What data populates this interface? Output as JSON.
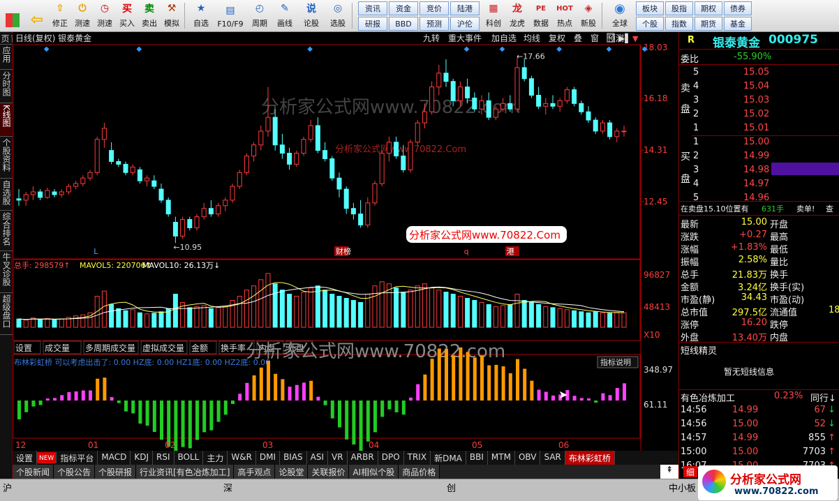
{
  "toolbar": {
    "nav": [
      {
        "label": "",
        "icon": "back-arrow-icon"
      },
      {
        "label": "修正",
        "icon": "up-arrow-icon"
      },
      {
        "label": "测速",
        "icon": "power-icon"
      },
      {
        "label": "测速",
        "icon": "clock-icon"
      },
      {
        "label": "买入",
        "icon": "buy-icon",
        "glyph": "买"
      },
      {
        "label": "卖出",
        "icon": "sell-icon",
        "glyph": "卖"
      },
      {
        "label": "模拟",
        "icon": "hammer-icon"
      }
    ],
    "mid": [
      {
        "label": "自选"
      },
      {
        "label": "F10/F9"
      },
      {
        "label": "周期"
      },
      {
        "label": "画线"
      },
      {
        "label": "论股"
      },
      {
        "label": "选股"
      }
    ],
    "grid1": [
      "资讯",
      "资金",
      "竞价",
      "陆港",
      "研报",
      "BBD",
      "预测",
      "沪伦"
    ],
    "apps": [
      {
        "label": "科创"
      },
      {
        "label": "龙虎"
      },
      {
        "label": "数据",
        "glyph": "PE"
      },
      {
        "label": "热点",
        "glyph": "HOT"
      },
      {
        "label": "新股"
      }
    ],
    "global": "全球",
    "grid2": [
      "板块",
      "股指",
      "期权",
      "债券",
      "个股",
      "指数",
      "期货",
      "基金"
    ]
  },
  "leftnav": [
    "首页",
    "应用",
    "分时图",
    "K线图",
    "个股资料",
    "自选股",
    "综合排名",
    "牛叉诊股",
    "超级盘口"
  ],
  "chart": {
    "header": "日线(复权)  银泰黄金",
    "buttons": [
      "九转",
      "重大事件",
      "加自选",
      "均线",
      "复权",
      "叠",
      "窗",
      "预测"
    ],
    "price_ticks": [
      "18.03",
      "16.18",
      "14.31",
      "12.45"
    ],
    "annot_high": "17.66",
    "annot_low": "10.95",
    "markers": [
      {
        "t": "L",
        "c": "#4af"
      },
      {
        "t": "财榜",
        "c": "#fff",
        "bg": "#a00"
      },
      {
        "t": "q",
        "c": "#f44"
      },
      {
        "t": "港",
        "c": "#fff",
        "bg": "#a00"
      }
    ],
    "watermark1": "分析家公式网www.70822.com",
    "watermark2": "分析家公式网www.70822.Com",
    "watermark3": "分析家公式网www.70822.Com",
    "watermark4": "分析家公式网www.70822.com",
    "vol_header": {
      "total": "总手: 298579↑",
      "ma5": "MAVOL5: 220706↑",
      "ma10": "MAVOL10: 26.13万↓"
    },
    "vol_ticks": [
      "96827",
      "48413",
      "X10"
    ],
    "vol_tabs": [
      "设置",
      "成交量",
      "多周期成交量",
      "虚拟成交量",
      "金额",
      "换手率",
      "内盘",
      "外盘"
    ],
    "ind_header": "布林彩虹桥  可以考虑出击了: 0.00  HZ底: 0.00  HZ1底: 0.00  HZ2底: 0.00",
    "ind_btn": "指标说明",
    "ind_ticks": [
      "348.97",
      "61.11"
    ],
    "months": [
      "12",
      "01",
      "02",
      "03",
      "04",
      "05",
      "06"
    ]
  },
  "chart_data": [
    {
      "type": "candlestick",
      "title": "银泰黄金 日线(复权)",
      "ylim": [
        10.5,
        18.03
      ],
      "ohlc": [
        [
          12.55,
          12.9,
          12.3,
          12.5
        ],
        [
          12.5,
          12.8,
          12.3,
          12.7
        ],
        [
          12.7,
          13.0,
          12.5,
          12.8
        ],
        [
          12.8,
          12.9,
          12.5,
          12.6
        ],
        [
          12.6,
          12.95,
          12.55,
          12.85
        ],
        [
          12.8,
          12.9,
          12.6,
          12.7
        ],
        [
          12.7,
          12.9,
          12.6,
          12.8
        ],
        [
          12.8,
          13.1,
          12.7,
          13.0
        ],
        [
          13.0,
          13.2,
          12.9,
          13.1
        ],
        [
          13.1,
          13.4,
          13.0,
          13.3
        ],
        [
          13.3,
          13.6,
          13.2,
          13.5
        ],
        [
          13.5,
          14.8,
          13.4,
          14.7
        ],
        [
          14.7,
          15.3,
          14.4,
          15.1
        ],
        [
          14.3,
          14.6,
          13.8,
          13.9
        ],
        [
          13.9,
          14.0,
          13.7,
          13.8
        ],
        [
          13.8,
          13.9,
          13.4,
          13.5
        ],
        [
          13.5,
          13.8,
          13.4,
          13.7
        ],
        [
          13.6,
          13.7,
          13.1,
          13.2
        ],
        [
          13.2,
          13.4,
          13.0,
          13.3
        ],
        [
          13.2,
          13.4,
          12.9,
          13.0
        ],
        [
          12.9,
          13.1,
          12.4,
          12.5
        ],
        [
          12.5,
          12.6,
          11.9,
          12.0
        ],
        [
          11.7,
          11.9,
          10.95,
          11.2
        ],
        [
          11.2,
          11.9,
          11.1,
          11.8
        ],
        [
          11.8,
          11.9,
          11.4,
          11.5
        ],
        [
          11.5,
          12.0,
          11.4,
          11.9
        ],
        [
          11.9,
          12.4,
          11.8,
          12.2
        ],
        [
          12.2,
          12.5,
          11.9,
          12.0
        ],
        [
          12.0,
          12.4,
          11.9,
          12.3
        ],
        [
          12.3,
          12.6,
          12.1,
          12.5
        ],
        [
          12.5,
          13.1,
          12.4,
          13.0
        ],
        [
          13.0,
          13.6,
          12.9,
          13.5
        ],
        [
          13.5,
          14.2,
          13.4,
          14.1
        ],
        [
          14.1,
          14.6,
          13.9,
          14.5
        ],
        [
          14.5,
          15.2,
          14.3,
          15.0
        ],
        [
          15.0,
          16.6,
          14.8,
          15.5
        ],
        [
          15.5,
          15.8,
          14.3,
          14.5
        ],
        [
          14.5,
          14.9,
          14.0,
          14.2
        ],
        [
          14.2,
          14.4,
          13.6,
          13.8
        ],
        [
          13.8,
          14.3,
          13.7,
          14.2
        ],
        [
          14.2,
          14.8,
          14.1,
          14.7
        ],
        [
          14.7,
          15.4,
          14.6,
          15.2
        ],
        [
          15.2,
          15.5,
          14.2,
          14.3
        ],
        [
          14.3,
          14.6,
          13.9,
          14.0
        ],
        [
          14.0,
          14.1,
          13.2,
          13.3
        ],
        [
          13.3,
          13.5,
          12.6,
          12.9
        ],
        [
          12.9,
          13.0,
          12.0,
          12.2
        ],
        [
          12.2,
          12.4,
          11.8,
          12.0
        ],
        [
          12.0,
          12.5,
          11.5,
          11.6
        ],
        [
          11.6,
          12.6,
          11.5,
          12.4
        ],
        [
          12.4,
          13.2,
          12.3,
          13.1
        ],
        [
          13.1,
          14.3,
          13.0,
          14.2
        ],
        [
          14.2,
          14.8,
          13.9,
          14.6
        ],
        [
          14.6,
          14.8,
          14.0,
          14.1
        ],
        [
          14.1,
          14.5,
          13.5,
          13.6
        ],
        [
          13.6,
          14.7,
          13.5,
          14.6
        ],
        [
          14.6,
          15.4,
          14.5,
          15.3
        ],
        [
          15.3,
          16.0,
          15.1,
          15.7
        ],
        [
          15.7,
          16.8,
          15.6,
          16.6
        ],
        [
          16.6,
          17.4,
          16.3,
          17.1
        ],
        [
          17.1,
          17.6,
          16.6,
          16.8
        ],
        [
          16.8,
          16.9,
          15.9,
          16.1
        ],
        [
          16.1,
          16.8,
          15.9,
          16.6
        ],
        [
          16.6,
          16.9,
          16.0,
          16.2
        ],
        [
          16.2,
          16.4,
          15.7,
          15.8
        ],
        [
          15.8,
          16.3,
          15.6,
          16.1
        ],
        [
          16.1,
          16.4,
          15.4,
          15.5
        ],
        [
          15.5,
          15.9,
          15.4,
          15.8
        ],
        [
          15.8,
          16.2,
          15.7,
          16.0
        ],
        [
          16.0,
          16.3,
          15.7,
          15.8
        ],
        [
          15.8,
          17.66,
          15.7,
          17.3
        ],
        [
          17.3,
          17.6,
          16.8,
          16.9
        ],
        [
          16.9,
          17.0,
          16.2,
          16.3
        ],
        [
          16.3,
          16.6,
          15.8,
          15.9
        ],
        [
          15.9,
          16.2,
          15.6,
          16.0
        ],
        [
          16.0,
          16.3,
          15.8,
          15.9
        ],
        [
          15.9,
          16.2,
          15.7,
          16.1
        ],
        [
          16.1,
          16.6,
          16.0,
          16.5
        ],
        [
          16.5,
          16.6,
          15.9,
          16.0
        ],
        [
          16.0,
          16.1,
          15.6,
          15.7
        ],
        [
          15.7,
          15.9,
          15.3,
          15.4
        ],
        [
          15.4,
          15.5,
          14.9,
          15.0
        ],
        [
          15.0,
          15.4,
          14.9,
          15.3
        ],
        [
          15.3,
          15.4,
          14.7,
          14.8
        ],
        [
          14.8,
          15.1,
          14.6,
          15.0
        ],
        [
          15.0,
          15.2,
          14.8,
          15.0
        ]
      ]
    },
    {
      "type": "bar",
      "title": "成交量",
      "series": [
        {
          "name": "总手",
          "values": [
            40,
            35,
            45,
            38,
            42,
            36,
            40,
            48,
            55,
            60,
            70,
            150,
            175,
            110,
            90,
            80,
            85,
            70,
            65,
            68,
            75,
            90,
            160,
            120,
            95,
            100,
            105,
            90,
            95,
            100,
            130,
            150,
            180,
            200,
            230,
            260,
            210,
            180,
            160,
            150,
            170,
            190,
            200,
            180,
            160,
            150,
            140,
            130,
            120,
            160,
            200,
            220,
            210,
            190,
            170,
            180,
            200,
            210,
            190,
            180,
            170,
            160,
            150,
            140,
            130,
            120,
            110,
            100,
            105,
            110,
            160,
            130,
            120,
            110,
            100,
            95,
            90,
            85,
            80,
            75,
            70,
            75,
            70,
            68,
            72,
            70
          ]
        },
        {
          "name": "MAVOL5",
          "values": [
            220706
          ]
        },
        {
          "name": "MAVOL10",
          "values": [
            261300
          ]
        }
      ]
    },
    {
      "type": "bar",
      "title": "布林彩虹桥",
      "ylim": [
        -150,
        348.97
      ]
    }
  ],
  "quote": {
    "code": "R",
    "name": "银泰黄金",
    "stock_code": "000975",
    "wb_label": "委比",
    "wb": "-55.90%",
    "sell_label": [
      "卖",
      "盘"
    ],
    "buy_label": [
      "买",
      "盘"
    ],
    "asks": [
      {
        "lv": "5",
        "p": "15.05",
        "v": ""
      },
      {
        "lv": "4",
        "p": "15.04",
        "v": ""
      },
      {
        "lv": "3",
        "p": "15.03",
        "v": ""
      },
      {
        "lv": "2",
        "p": "15.02",
        "v": ""
      },
      {
        "lv": "1",
        "p": "15.01",
        "v": ""
      }
    ],
    "bids": [
      {
        "lv": "1",
        "p": "15.00",
        "v": ""
      },
      {
        "lv": "2",
        "p": "14.99",
        "v": ""
      },
      {
        "lv": "3",
        "p": "14.98",
        "v": ""
      },
      {
        "lv": "4",
        "p": "14.97",
        "v": ""
      },
      {
        "lv": "5",
        "p": "14.96",
        "v": ""
      }
    ],
    "notice": "在卖盘15.10位置有",
    "notice_vol": "631手",
    "notice_tail": "卖单!",
    "notice_btn": "查",
    "stats": [
      [
        "最新",
        "15.00",
        "开盘",
        ""
      ],
      [
        "涨跌",
        "+0.27",
        "最高",
        ""
      ],
      [
        "涨幅",
        "+1.83%",
        "最低",
        ""
      ],
      [
        "振幅",
        "2.58%",
        "量比",
        ""
      ],
      [
        "总手",
        "21.83万",
        "换手",
        ""
      ],
      [
        "金额",
        "3.24亿",
        "换手(实)",
        ""
      ],
      [
        "市盈(静)",
        "34.43",
        "市盈(动)",
        ""
      ],
      [
        "总市值",
        "297.5亿",
        "流通值",
        "18"
      ],
      [
        "涨停",
        "16.20",
        "跌停",
        ""
      ],
      [
        "外盘",
        "13.40万",
        "内盘",
        ""
      ]
    ],
    "short_title": "短线精灵",
    "short_empty": "暂无短线信息",
    "industry": "有色冶炼加工",
    "industry_pct": "0.23%",
    "industry_btn": "同行↓",
    "ticks": [
      [
        "14:56",
        "14.99",
        "67",
        "dn"
      ],
      [
        "14:56",
        "15.00",
        "52",
        "dn"
      ],
      [
        "14:57",
        "14.99",
        "855",
        "up"
      ],
      [
        "15:00",
        "15.00",
        "7703",
        "up"
      ],
      [
        "16:07",
        "15.00",
        "7703",
        "up"
      ]
    ],
    "bottom_btn": "细"
  },
  "tabs": [
    "设置",
    "NEW",
    "指标平台",
    "MACD",
    "KDJ",
    "RSI",
    "BOLL",
    "主力",
    "W&R",
    "DMI",
    "BIAS",
    "ASI",
    "VR",
    "ARBR",
    "DPO",
    "TRIX",
    "新DMA",
    "BBI",
    "MTM",
    "OBV",
    "SAR",
    "布林彩虹桥"
  ],
  "tabs2": [
    "个股新闻",
    "个股公告",
    "个股研报",
    "行业资讯[有色冶炼加工]",
    "高手观点",
    "论股堂",
    "关联报价",
    "AI相似个股",
    "商品价格"
  ],
  "status": {
    "sh": "沪",
    "sz": "深",
    "cy": "创",
    "zx": "中小板",
    "logo": "分析家公式网",
    "logo_url": "www.70822.com"
  },
  "colors": {
    "up": "#ff3c3c",
    "down": "#54ffff",
    "green": "#22cc22",
    "magenta": "#ff40ff",
    "orange": "#ff9a00"
  }
}
